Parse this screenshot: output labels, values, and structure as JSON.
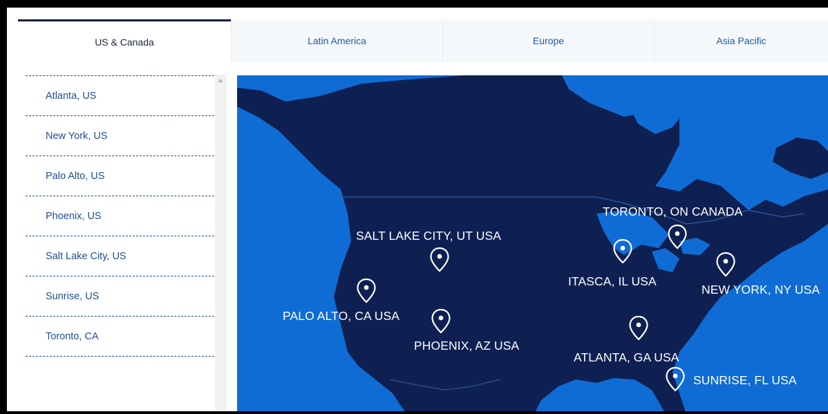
{
  "tabs": [
    {
      "label": "US & Canada"
    },
    {
      "label": "Latin America"
    },
    {
      "label": "Europe"
    },
    {
      "label": "Asia Pacific"
    }
  ],
  "locations": [
    {
      "label": "Atlanta, US"
    },
    {
      "label": "New York, US"
    },
    {
      "label": "Palo Alto, US"
    },
    {
      "label": "Phoenix, US"
    },
    {
      "label": "Salt Lake City, US"
    },
    {
      "label": "Sunrise, US"
    },
    {
      "label": "Toronto, CA"
    }
  ],
  "map_labels": {
    "toronto": "TORONTO, ON CANADA",
    "salt_lake": "SALT LAKE CITY, UT USA",
    "itasca": "ITASCA, IL USA",
    "new_york": "NEW YORK, NY USA",
    "palo_alto": "PALO ALTO, CA USA",
    "phoenix": "PHOENIX, AZ USA",
    "atlanta": "ATLANTA, GA USA",
    "sunrise": "SUNRISE, FL USA"
  },
  "colors": {
    "ocean": "#0f6cd4",
    "land": "#0e2052",
    "accent": "#0d1a3d",
    "link": "#1c4f8f"
  }
}
